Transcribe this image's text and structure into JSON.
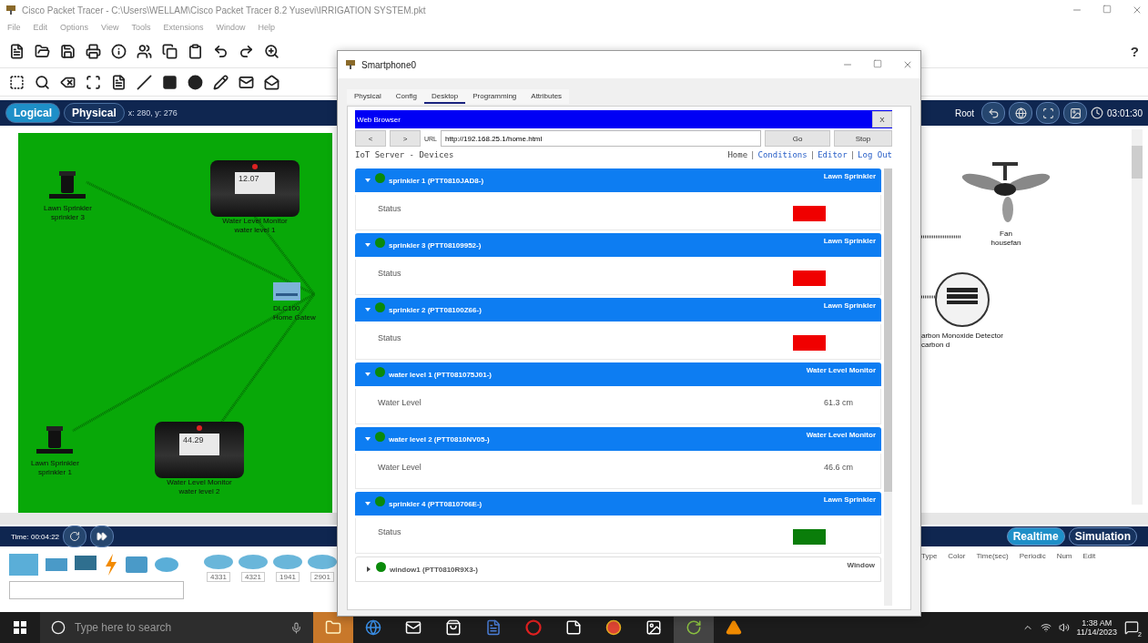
{
  "window": {
    "title": "Cisco Packet Tracer - C:\\Users\\WELLAM\\Cisco Packet Tracer 8.2 Yusevi\\IRRIGATION SYSTEM.pkt"
  },
  "menu": [
    "File",
    "Edit",
    "Options",
    "View",
    "Tools",
    "Extensions",
    "Window",
    "Help"
  ],
  "help": "?",
  "view_bar": {
    "tabs": [
      {
        "label": "Logical",
        "selected": true
      },
      {
        "label": "Physical",
        "selected": false
      }
    ],
    "coords": "x: 280, y: 276",
    "path": "Root",
    "clock": "03:01:30"
  },
  "canvas": {
    "nodes": [
      {
        "kind": "sprinkler",
        "type": "Lawn Sprinkler",
        "name": "sprinkler 3"
      },
      {
        "kind": "monitor",
        "reading": "12.07",
        "type": "Water Level Monitor",
        "name": "water level 1"
      },
      {
        "kind": "gateway",
        "type": "DLC100",
        "name": "Home Gatew"
      },
      {
        "kind": "sprinkler",
        "type": "Lawn Sprinkler",
        "name": "sprinkler 1"
      },
      {
        "kind": "monitor",
        "reading": "44.29",
        "type": "Water Level Monitor",
        "name": "water level 2"
      },
      {
        "kind": "fan",
        "type": "Fan",
        "name": "housefan"
      },
      {
        "kind": "detector",
        "type": "arbon Monoxide Detector",
        "name": "carbon d"
      }
    ]
  },
  "sim_bar": {
    "time": "Time: 00:04:22",
    "modes": [
      {
        "label": "Realtime",
        "selected": true
      },
      {
        "label": "Simulation",
        "selected": false
      }
    ]
  },
  "event_list": {
    "columns": [
      "Type",
      "Color",
      "Time(sec)",
      "Periodic",
      "Num",
      "Edit"
    ]
  },
  "palette": {
    "models": [
      "4331",
      "4321",
      "1941",
      "2901"
    ]
  },
  "taskbar": {
    "search_placeholder": "Type here to search",
    "time": "1:38 AM",
    "date": "11/14/2023",
    "notifications": "2"
  },
  "dialog": {
    "title": "Smartphone0",
    "tabs": [
      {
        "label": "Physical",
        "selected": false
      },
      {
        "label": "Config",
        "selected": false
      },
      {
        "label": "Desktop",
        "selected": true
      },
      {
        "label": "Programming",
        "selected": false
      },
      {
        "label": "Attributes",
        "selected": false
      }
    ],
    "browser": {
      "title": "Web Browser",
      "close": "X",
      "back": "<",
      "forward": ">",
      "url_label": "URL",
      "url": "http://192.168.25.1/home.html",
      "go": "Go",
      "stop": "Stop",
      "page_title": "IoT Server - Devices",
      "nav": [
        "Home",
        "Conditions",
        "Editor",
        "Log Out"
      ],
      "nav_separator": "|",
      "devices": [
        {
          "name": "sprinkler 1 (PTT0810JAD8-)",
          "type": "Lawn Sprinkler",
          "expanded": true,
          "online": true,
          "field": {
            "kind": "status",
            "label": "Status",
            "on": false
          }
        },
        {
          "name": "sprinkler 3 (PTT08109952-)",
          "type": "Lawn Sprinkler",
          "expanded": true,
          "online": true,
          "field": {
            "kind": "status",
            "label": "Status",
            "on": false
          }
        },
        {
          "name": "sprinkler 2 (PTT08100Z66-)",
          "type": "Lawn Sprinkler",
          "expanded": true,
          "online": true,
          "field": {
            "kind": "status",
            "label": "Status",
            "on": false
          }
        },
        {
          "name": "water level 1 (PTT081075J01-)",
          "type": "Water Level Monitor",
          "expanded": true,
          "online": true,
          "field": {
            "kind": "reading",
            "label": "Water Level",
            "value": "61.3 cm"
          }
        },
        {
          "name": "water level 2 (PTT0810NV05-)",
          "type": "Water Level Monitor",
          "expanded": true,
          "online": true,
          "field": {
            "kind": "reading",
            "label": "Water Level",
            "value": "46.6 cm"
          }
        },
        {
          "name": "sprinkler 4 (PTT0810706E-)",
          "type": "Lawn Sprinkler",
          "expanded": true,
          "online": true,
          "field": {
            "kind": "status",
            "label": "Status",
            "on": true
          }
        },
        {
          "name": "window1 (PTT0810R9X3-)",
          "type": "Window",
          "expanded": false,
          "online": true
        }
      ]
    }
  }
}
